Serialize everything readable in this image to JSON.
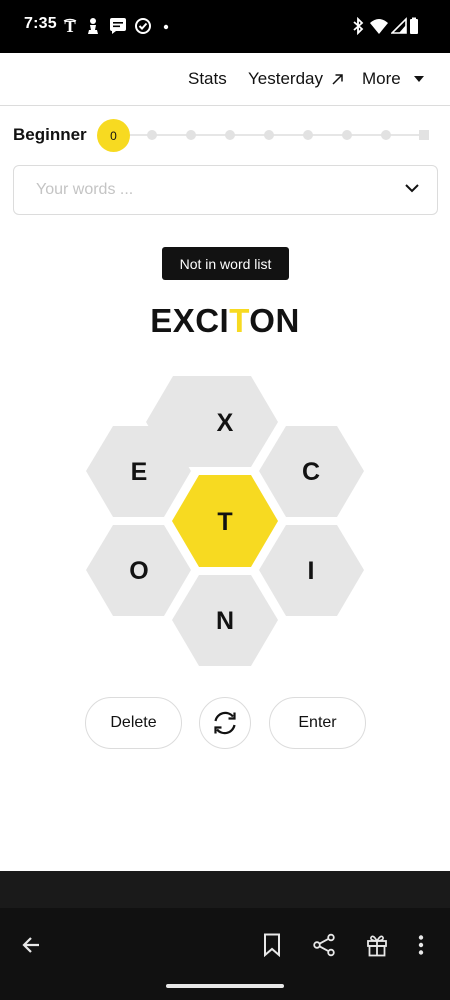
{
  "status_bar": {
    "time": "7:35",
    "left_icons": [
      "nyt-logo-icon",
      "chess-pawn-icon",
      "message-icon",
      "check-circle-icon",
      "dot-icon"
    ],
    "right_icons": [
      "bluetooth-icon",
      "wifi-icon",
      "signal-icon",
      "battery-icon"
    ]
  },
  "nav": {
    "stats": "Stats",
    "yesterday": "Yesterday",
    "more": "More"
  },
  "progress": {
    "rank": "Beginner",
    "score": "0",
    "level": 0,
    "total_steps": 9
  },
  "word_list": {
    "placeholder": "Your words ..."
  },
  "toast": "Not in word list",
  "current_word": {
    "before_center": "EXCI",
    "center": "T",
    "after_center": "ON"
  },
  "hive": {
    "center_letter": "T",
    "outer_letters": {
      "top": "X",
      "upper_left": "E",
      "upper_right": "C",
      "lower_left": "O",
      "lower_right": "I",
      "bottom": "N"
    }
  },
  "controls": {
    "delete": "Delete",
    "enter": "Enter"
  },
  "colors": {
    "accent": "#f7da21",
    "cell": "#e6e6e6",
    "text": "#121212",
    "toolbar": "#111111"
  },
  "toolbar": {
    "icons": [
      "back-arrow-icon",
      "bookmark-icon",
      "share-icon",
      "gift-icon",
      "more-vertical-icon"
    ]
  }
}
